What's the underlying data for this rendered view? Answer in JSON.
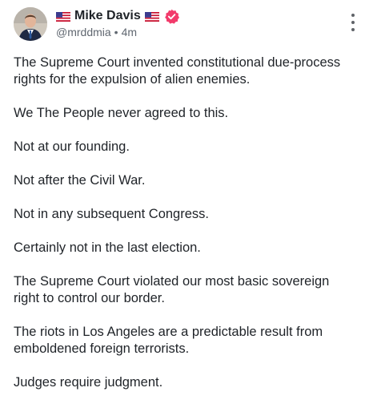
{
  "author": {
    "flag_left": "🇺🇸",
    "name": "Mike Davis",
    "flag_right": "🇺🇸",
    "handle": "@mrddmia",
    "separator": "•",
    "time": "4m",
    "verified": true
  },
  "colors": {
    "verified_badge": "#f23b6b",
    "text": "#1f2328",
    "meta": "#606770"
  },
  "icons": {
    "more": "more-vertical-icon",
    "verified": "verified-badge-icon"
  },
  "post": {
    "paragraphs": [
      "The Supreme Court invented constitutional due-process rights for the expulsion of alien enemies.",
      "We The People never agreed to this.",
      "Not at our founding.",
      "Not after the Civil War.",
      "Not in any subsequent Congress.",
      "Certainly not in the last election.",
      "The Supreme Court violated our most basic sovereign right to control our border.",
      "The riots in Los Angeles are a predictable result from emboldened foreign terrorists.",
      "Judges require judgment."
    ]
  }
}
